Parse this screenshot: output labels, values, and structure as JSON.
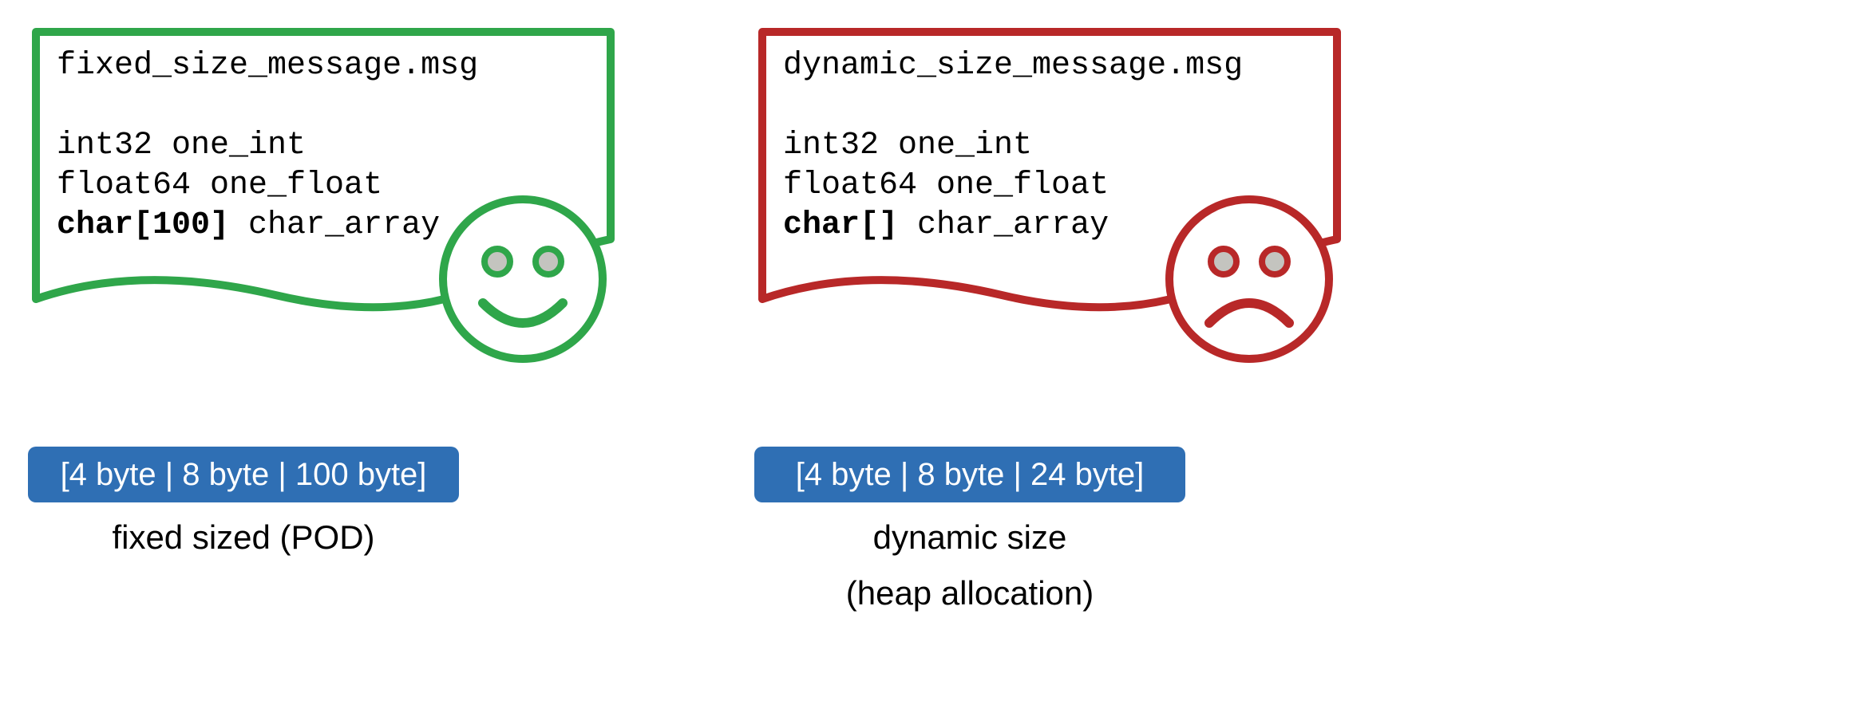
{
  "colors": {
    "green": "#2fa64a",
    "red": "#b82828",
    "pill": "#2f6fb4",
    "eye": "#c4c4bf"
  },
  "left": {
    "filename": "fixed_size_message.msg",
    "lines": [
      {
        "pre": "int32 one_int",
        "bold": ""
      },
      {
        "pre": "float64 one_float",
        "bold": ""
      }
    ],
    "bold_type": "char[100]",
    "bold_rest": " char_array",
    "bytes": "[4 byte | 8 byte | 100 byte]",
    "caption1": "fixed sized (POD)"
  },
  "right": {
    "filename": "dynamic_size_message.msg",
    "lines": [
      {
        "pre": "int32 one_int",
        "bold": ""
      },
      {
        "pre": "float64 one_float",
        "bold": ""
      }
    ],
    "bold_type": "char[]",
    "bold_rest": " char_array",
    "bytes": "[4 byte | 8 byte | 24 byte]",
    "caption1": "dynamic size",
    "caption2": "(heap allocation)"
  }
}
